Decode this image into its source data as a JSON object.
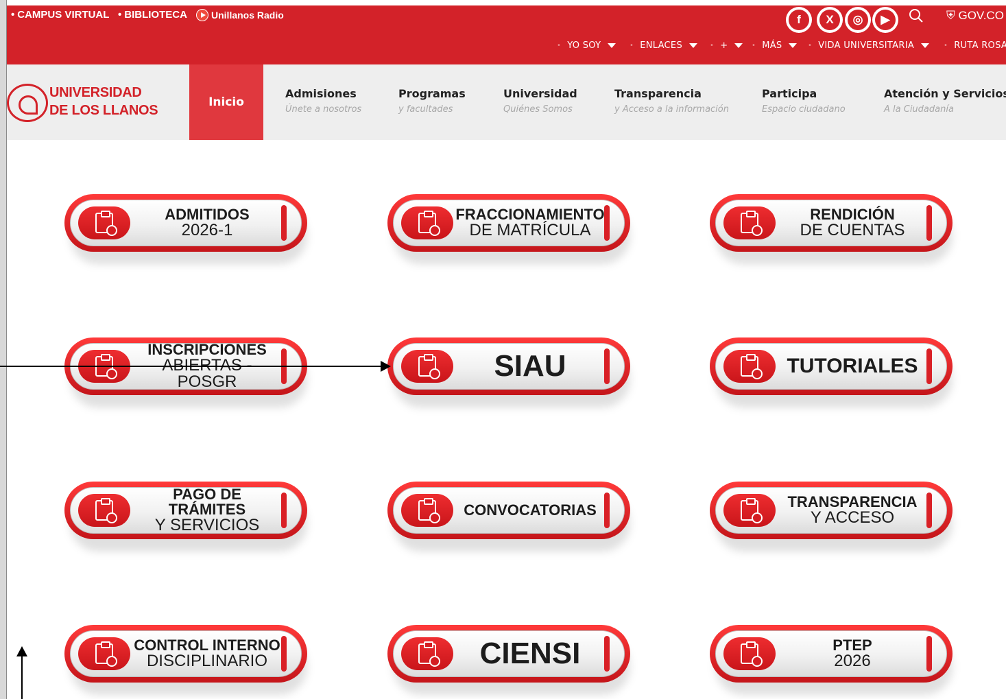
{
  "topbar": {
    "campus_virtual": "CAMPUS VIRTUAL",
    "biblioteca": "BIBLIOTECA",
    "radio": "Unillanos Radio",
    "social": [
      {
        "name": "facebook-icon",
        "glyph": "f"
      },
      {
        "name": "x-icon",
        "glyph": "X"
      },
      {
        "name": "instagram-icon",
        "glyph": "◎"
      },
      {
        "name": "youtube-icon",
        "glyph": "▶"
      }
    ],
    "gov": "GOV.CO",
    "secondary_nav": [
      "YO SOY",
      "ENLACES",
      "+",
      "MÁS",
      "VIDA UNIVERSITARIA",
      "RUTA ROSA"
    ]
  },
  "header": {
    "logo_line1": "UNIVERSIDAD",
    "logo_line2": "DE LOS LLANOS",
    "inicio": "Inicio",
    "nav": [
      {
        "title": "Admisiones",
        "subtitle": "Únete a nosotros"
      },
      {
        "title": "Programas",
        "subtitle": "y facultades"
      },
      {
        "title": "Universidad",
        "subtitle": "Quiénes Somos"
      },
      {
        "title": "Transparencia",
        "subtitle": "y Acceso a la información"
      },
      {
        "title": "Participa",
        "subtitle": "Espacio ciudadano"
      },
      {
        "title": "Atención y Servicios",
        "subtitle": "A la Ciudadanía"
      }
    ]
  },
  "buttons": [
    {
      "line1": "ADMITIDOS",
      "line2": "2026-1",
      "style": "normal"
    },
    {
      "line1": "FRACCIONAMIENTO",
      "line2": "DE MATRÍCULA",
      "style": "normal"
    },
    {
      "line1": "RENDICIÓN",
      "line2": "DE CUENTAS",
      "style": "normal"
    },
    {
      "line1": "INSCRIPCIONES",
      "line2": "ABIERTAS - POSGR",
      "style": "normal"
    },
    {
      "line1": "SIAU",
      "line2": "",
      "style": "big"
    },
    {
      "line1": "TUTORIALES",
      "line2": "",
      "style": "medium"
    },
    {
      "line1": "PAGO DE TRÁMITES",
      "line2": "Y SERVICIOS",
      "style": "normal"
    },
    {
      "line1": "CONVOCATORIAS",
      "line2": "",
      "style": "normal"
    },
    {
      "line1": "TRANSPARENCIA",
      "line2": "Y ACCESO",
      "style": "normal"
    },
    {
      "line1": "CONTROL INTERNO",
      "line2": "DISCIPLINARIO",
      "style": "normal"
    },
    {
      "line1": "CIENSI",
      "line2": "",
      "style": "big"
    },
    {
      "line1": "PTEP",
      "line2": "2026",
      "style": "normal"
    }
  ],
  "colors": {
    "brand_red": "#d32229",
    "nav_bg": "#eeeeee",
    "active_tab": "#e0383e"
  }
}
